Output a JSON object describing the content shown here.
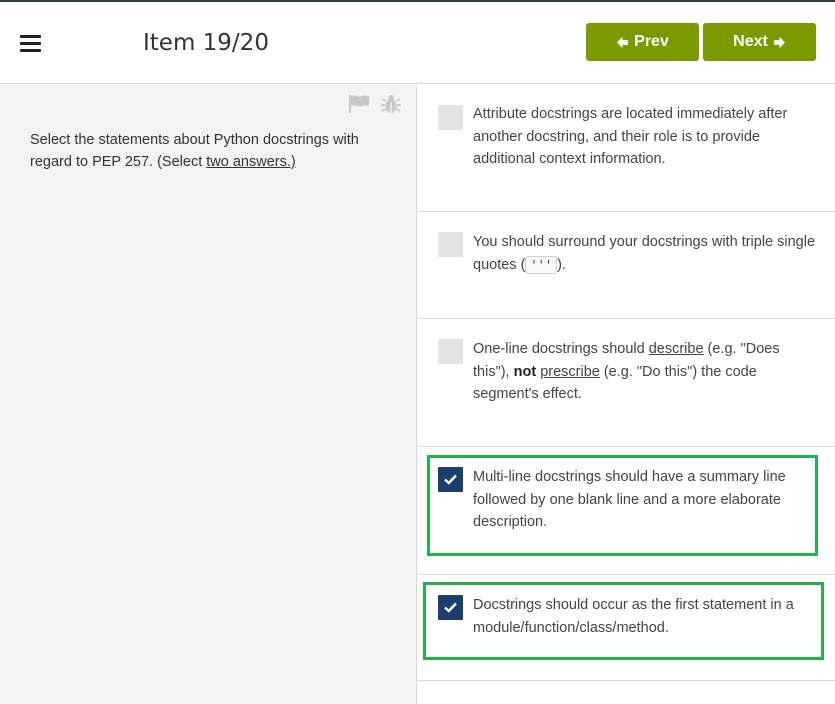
{
  "header": {
    "title": "Item 19/20",
    "prev_label": "Prev",
    "next_label": "Next"
  },
  "question": {
    "text_before": "Select the statements about Python docstrings with regard to PEP 257. (Select ",
    "text_link": "two answers.)"
  },
  "options": [
    {
      "checked": false,
      "text": "Attribute docstrings are located immediately after another docstring, and their role is to provide additional context information."
    },
    {
      "checked": false,
      "text_before": "You should surround your docstrings with triple single quotes (",
      "code": "'''",
      "text_after": ")."
    },
    {
      "checked": false,
      "p1": "One-line docstrings should ",
      "u1": "describe",
      "p2": " (e.g. \"Does this\"), ",
      "b1": "not",
      "p3": " ",
      "u2": "prescribe",
      "p4": " (e.g. \"Do this\") the code segment's effect."
    },
    {
      "checked": true,
      "text": "Multi-line docstrings should have a summary line followed by one blank line and a more elaborate description."
    },
    {
      "checked": true,
      "text": "Docstrings should occur as the first statement in a module/function/class/method."
    }
  ],
  "icons": {
    "menu": "hamburger-menu-icon",
    "flag": "flag-icon",
    "bug": "bug-icon",
    "prev": "arrow-left-icon",
    "next": "arrow-right-icon",
    "check": "checkmark-icon"
  },
  "colors": {
    "nav_button": "#7a9a01",
    "checkbox_checked": "#1d3d6b",
    "highlight": "#27ae4f"
  }
}
